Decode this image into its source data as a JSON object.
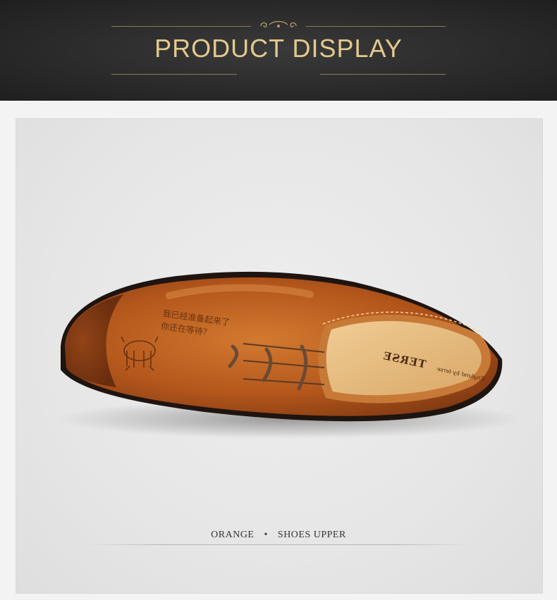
{
  "header": {
    "title": "PRODUCT DISPLAY"
  },
  "product": {
    "brand_label": "TERSE",
    "sub_label": "England by terse",
    "engraving_line1": "我已经准备起来了",
    "engraving_line2": "你还在等待？"
  },
  "caption": {
    "left": "ORANGE",
    "separator": "•",
    "right": "SHOES UPPER"
  },
  "colors": {
    "banner_bg": "#2b2b2b",
    "gold": "#e3c98d",
    "leather": "#b45a1f",
    "lining": "#e3b980"
  }
}
